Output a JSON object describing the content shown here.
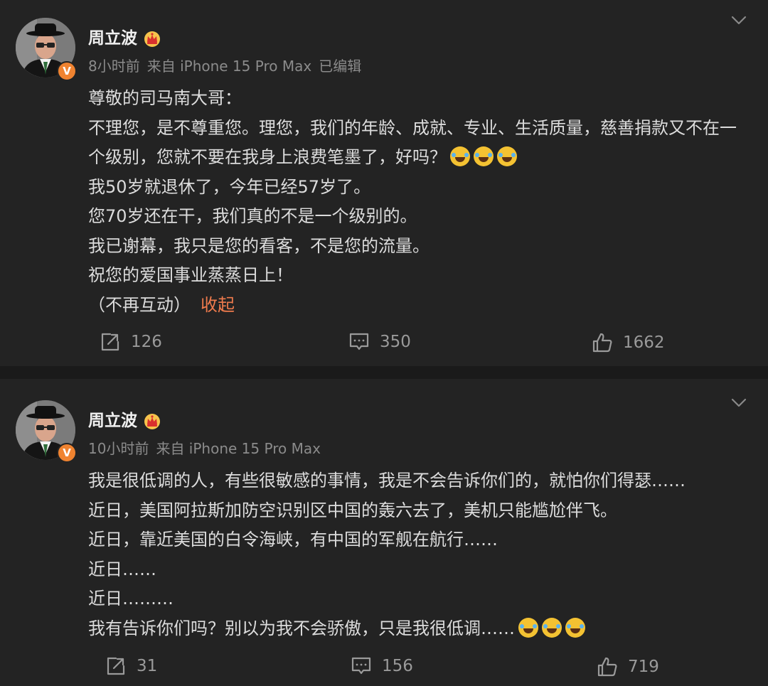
{
  "posts": [
    {
      "author": "周立波",
      "time": "8小时前",
      "source": "来自 iPhone 15 Pro Max",
      "edited": "已编辑",
      "lines": [
        "尊敬的司马南大哥：",
        "不理您，是不尊重您。理您，我们的年龄、成就、专业、生活质量，慈善捐款又不在一个级别，您就不要在我身上浪费笔墨了，好吗？",
        "我50岁就退休了，今年已经57岁了。",
        "您70岁还在干，我们真的不是一个级别的。",
        "我已谢幕，我只是您的看客，不是您的流量。",
        "祝您的爱国事业蒸蒸日上！",
        "（不再互动）"
      ],
      "collapse": "收起",
      "reposts": "126",
      "comments": "350",
      "likes": "1662"
    },
    {
      "author": "周立波",
      "time": "10小时前",
      "source": "来自 iPhone 15 Pro Max",
      "lines": [
        "我是很低调的人，有些很敏感的事情，我是不会告诉你们的，就怕你们得瑟……",
        "近日，美国阿拉斯加防空识别区中国的轰六去了，美机只能尴尬伴飞。",
        "近日，靠近美国的白令海峡，有中国的军舰在航行……",
        "近日……",
        "近日………",
        "我有告诉你们吗？别以为我不会骄傲，只是我很低调……"
      ],
      "reposts": "31",
      "comments": "156",
      "likes": "719"
    }
  ],
  "icons": {
    "verified": "verified-badge-icon",
    "crown": "member-crown-icon",
    "chevron": "chevron-down-icon",
    "repost": "repost-icon",
    "comment": "comment-icon",
    "like": "like-icon",
    "emoji": "laugh-cry-emoji"
  },
  "colors": {
    "background": "#232323",
    "accent": "#ef7b4d",
    "badge": "#f08330"
  }
}
